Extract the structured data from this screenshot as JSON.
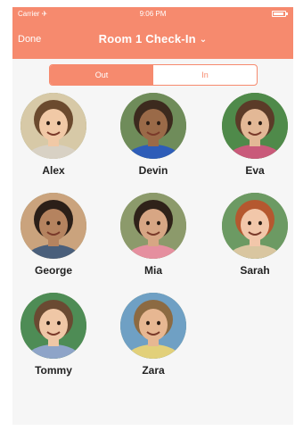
{
  "status_bar": {
    "carrier": "Carrier ✈",
    "time": "9:06 PM"
  },
  "nav": {
    "left_button": "Done",
    "title": "Room 1 Check-In",
    "title_icon": "chevron-down-icon"
  },
  "segments": [
    {
      "label": "Out",
      "selected": true
    },
    {
      "label": "In",
      "selected": false
    }
  ],
  "colors": {
    "accent": "#f68a6e",
    "background": "#f6f6f6"
  },
  "children": [
    {
      "name": "Alex",
      "bg": "#d7c9a7",
      "hair": "#6b4a2e",
      "skin": "#f1c9a6",
      "shirt": "#d8d1c4"
    },
    {
      "name": "Devin",
      "bg": "#6f8c5a",
      "hair": "#3c2a1e",
      "skin": "#9a6a48",
      "shirt": "#2e5db8"
    },
    {
      "name": "Eva",
      "bg": "#4f8a4a",
      "hair": "#5b3b28",
      "skin": "#e3b896",
      "shirt": "#c95a7a"
    },
    {
      "name": "George",
      "bg": "#caa37d",
      "hair": "#2b1f18",
      "skin": "#b5835f",
      "shirt": "#4a5f7b"
    },
    {
      "name": "Mia",
      "bg": "#8c9a6b",
      "hair": "#2f2219",
      "skin": "#d7a684",
      "shirt": "#e58f9f"
    },
    {
      "name": "Sarah",
      "bg": "#6c9a63",
      "hair": "#b5582f",
      "skin": "#f2c7aa",
      "shirt": "#d9c6a0"
    },
    {
      "name": "Tommy",
      "bg": "#4e8c55",
      "hair": "#6a4a32",
      "skin": "#efc7a6",
      "shirt": "#8ea4c8"
    },
    {
      "name": "Zara",
      "bg": "#6fa0c4",
      "hair": "#8c6a42",
      "skin": "#e7b792",
      "shirt": "#e2d07a"
    }
  ]
}
